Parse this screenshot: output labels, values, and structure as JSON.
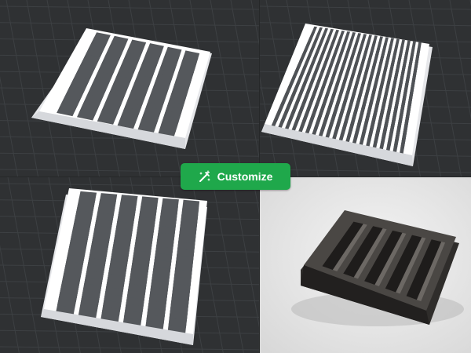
{
  "customize_button": {
    "label": "Customize",
    "icon": "customize-wand-icon",
    "color": "#1fa84b"
  },
  "colors": {
    "viewport_bg": "#2f3133",
    "grid_line": "#3d4043",
    "model_white": "#ffffff",
    "model_shade": "#c9cbcf",
    "photo_bg": "#e8e8e8",
    "print_dark": "#3a3836"
  },
  "previews": [
    {
      "name": "render-rectangular-slots-a",
      "pattern": "rectangular-slots"
    },
    {
      "name": "render-square-grid",
      "pattern": "square-grid"
    },
    {
      "name": "render-rectangular-slots-b",
      "pattern": "rectangular-slots"
    },
    {
      "name": "photo-printed-grate",
      "pattern": "photo"
    }
  ]
}
